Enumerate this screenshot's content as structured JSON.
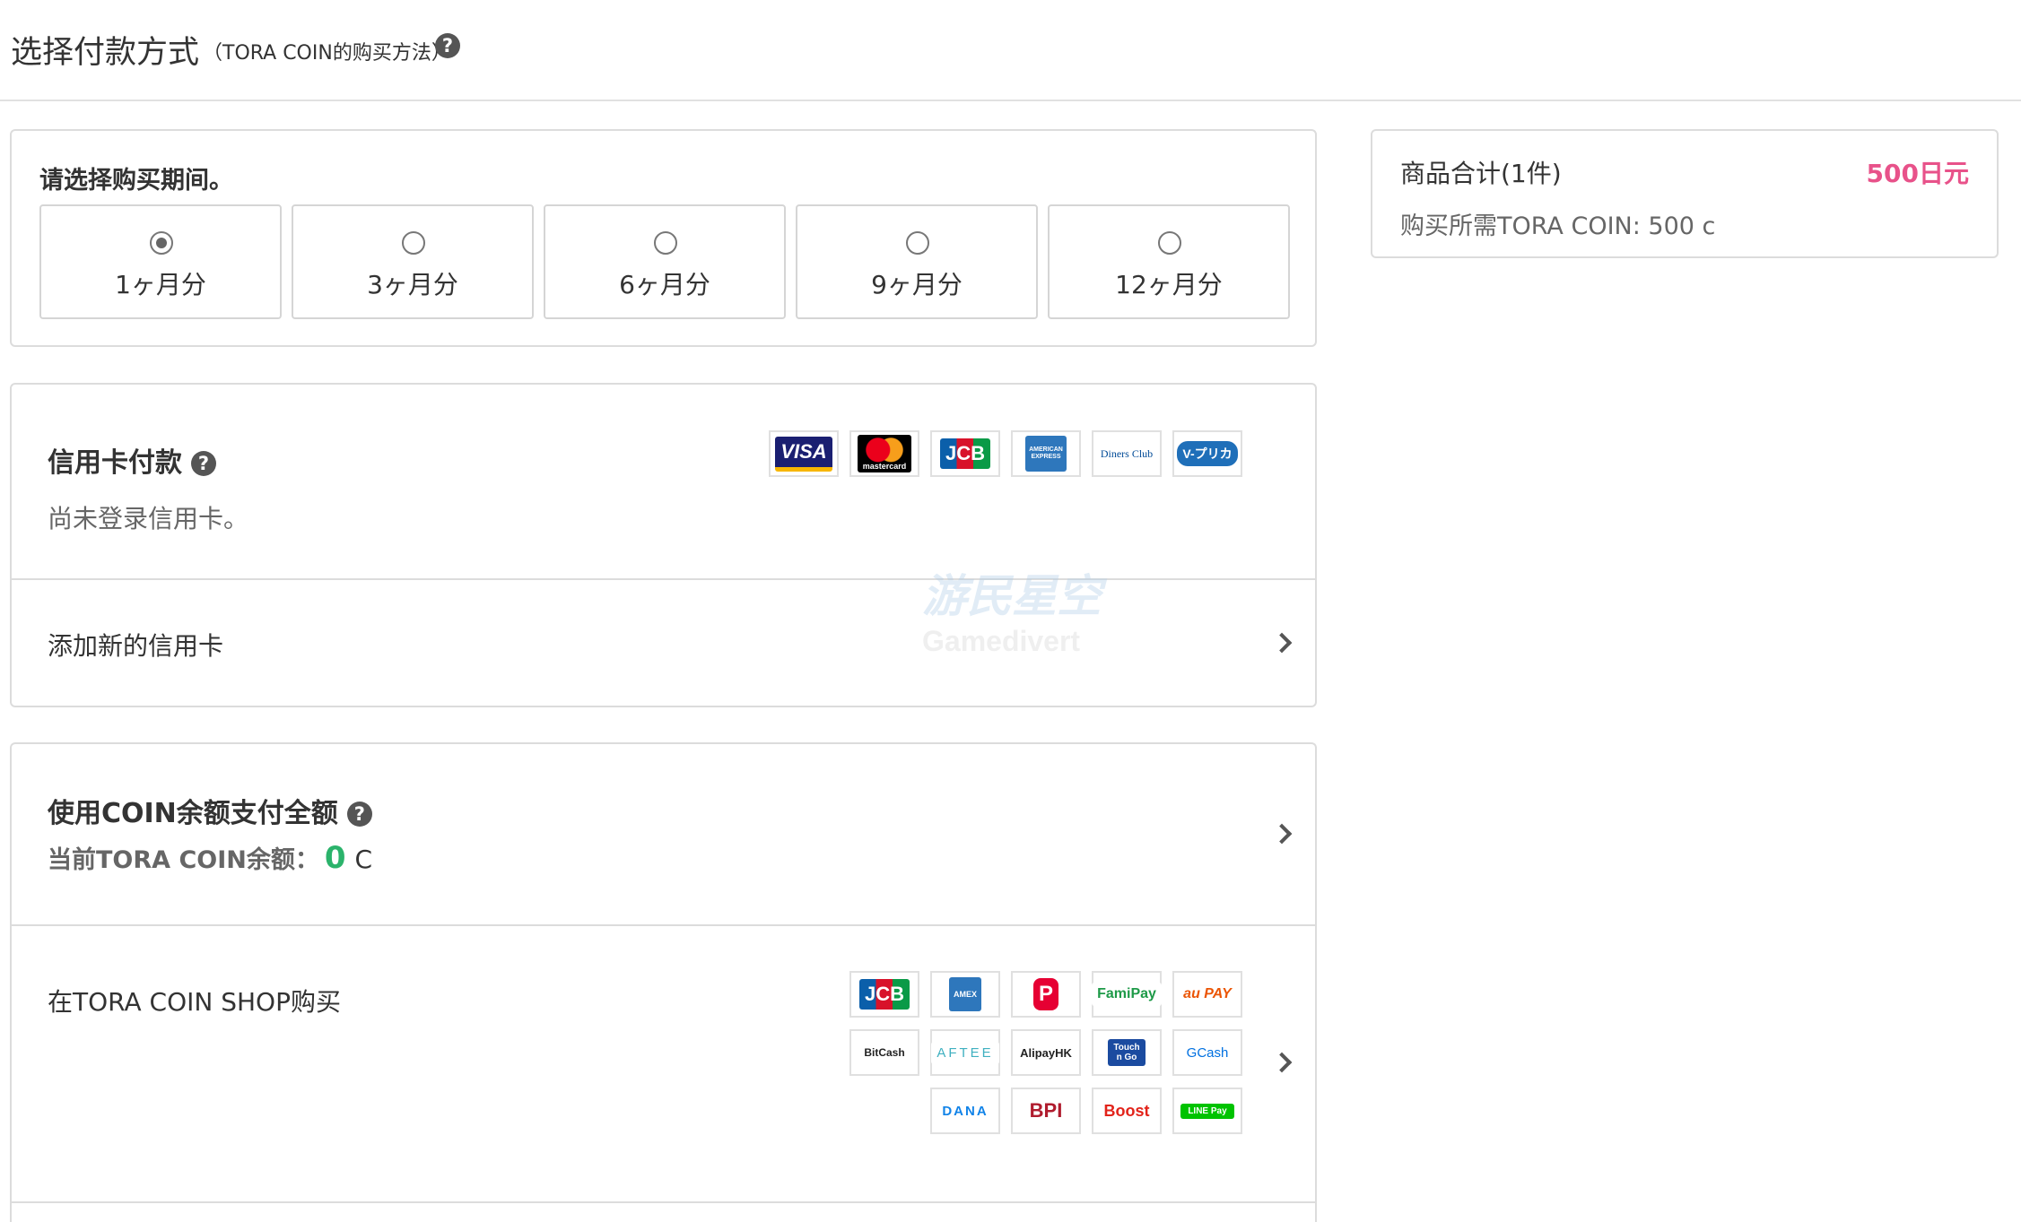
{
  "header": {
    "title": "选择付款方式",
    "subtitle": "（TORA COIN的购买方法）",
    "help_icon": "?"
  },
  "period": {
    "title": "请选择购买期间。",
    "selected_index": 0,
    "options": [
      {
        "label": "1ヶ月分"
      },
      {
        "label": "3ヶ月分"
      },
      {
        "label": "6ヶ月分"
      },
      {
        "label": "9ヶ月分"
      },
      {
        "label": "12ヶ月分"
      }
    ]
  },
  "credit_card": {
    "title": "信用卡付款",
    "status": "尚未登录信用卡。",
    "add_label": "添加新的信用卡",
    "brands": [
      {
        "name": "VISA",
        "bg": "#1a1f71",
        "fg": "#ffffff"
      },
      {
        "name": "mastercard",
        "bg": "#000000",
        "fg": "#ffffff"
      },
      {
        "name": "JCB",
        "bg": "#0b5faa",
        "fg": "#ffffff"
      },
      {
        "name": "AMERICAN EXPRESS",
        "bg": "#2e77bc",
        "fg": "#ffffff"
      },
      {
        "name": "Diners Club",
        "bg": "#ffffff",
        "fg": "#004a97"
      },
      {
        "name": "V-プリカ",
        "bg": "#1f6fb9",
        "fg": "#ffffff"
      }
    ],
    "watermark": "游民星空",
    "watermark_sub": "Gamedivert"
  },
  "coin": {
    "title": "使用COIN余额支付全额",
    "balance_label": "当前TORA COIN余额：",
    "balance_value": "0",
    "balance_unit": "C",
    "shop_label": "在TORA COIN SHOP购买",
    "shop_methods": [
      {
        "name": "JCB",
        "bg": "#0b5faa",
        "fg": "#ffffff"
      },
      {
        "name": "AMEX",
        "bg": "#2e77bc",
        "fg": "#ffffff"
      },
      {
        "name": "P",
        "bg": "#e60033",
        "fg": "#ffffff"
      },
      {
        "name": "FamiPay",
        "bg": "#ffffff",
        "fg": "#1e9a48"
      },
      {
        "name": "au PAY",
        "bg": "#ffffff",
        "fg": "#eb5505"
      },
      {
        "name": "BitCash",
        "bg": "#ffffff",
        "fg": "#222222"
      },
      {
        "name": "AFTEE",
        "bg": "#ffffff",
        "fg": "#3fb0c0"
      },
      {
        "name": "AlipayHK",
        "bg": "#ffffff",
        "fg": "#222222"
      },
      {
        "name": "Touch n Go",
        "bg": "#1b4ba0",
        "fg": "#ffffff"
      },
      {
        "name": "GCash",
        "bg": "#ffffff",
        "fg": "#0070e0"
      },
      {
        "name": "DANA",
        "bg": "#ffffff",
        "fg": "#1183e8"
      },
      {
        "name": "BPI",
        "bg": "#ffffff",
        "fg": "#b01c2e"
      },
      {
        "name": "Boost",
        "bg": "#ffffff",
        "fg": "#e2231a"
      },
      {
        "name": "LINE Pay",
        "bg": "#00c300",
        "fg": "#ffffff"
      }
    ]
  },
  "summary": {
    "label": "商品合计(1件)",
    "price": "500日元",
    "coin_required": "购买所需TORA COIN: 500 c"
  },
  "colors": {
    "accent_pink": "#e8528a",
    "balance_green": "#2bb36b",
    "border": "#dcdcdc"
  }
}
